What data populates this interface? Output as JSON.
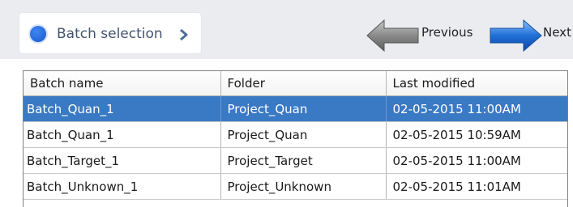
{
  "toolbar": {
    "breadcrumb_label": "Batch selection",
    "previous_label": "Previous",
    "next_label": "Next"
  },
  "grid": {
    "columns": [
      "Batch name",
      "Folder",
      "Last modified"
    ],
    "rows": [
      {
        "batch_name": "Batch_Quan_1",
        "folder": "Project_Quan",
        "last_modified": "02-05-2015 11:00AM",
        "selected": true
      },
      {
        "batch_name": "Batch_Quan_1",
        "folder": "Project_Quan",
        "last_modified": "02-05-2015 10:59AM",
        "selected": false
      },
      {
        "batch_name": "Batch_Target_1",
        "folder": "Project_Target",
        "last_modified": "02-05-2015 11:00AM",
        "selected": false
      },
      {
        "batch_name": "Batch_Unknown_1",
        "folder": "Project_Unknown",
        "last_modified": "02-05-2015 11:01AM",
        "selected": false
      }
    ]
  },
  "icons": {
    "breadcrumb_dot": "circle-dot-icon",
    "breadcrumb_chevron": "chevron-right-icon",
    "previous": "arrow-left-icon",
    "next": "arrow-right-icon"
  },
  "colors": {
    "selection": "#3a79c4",
    "dot_blue": "#2467d8",
    "next_arrow": "#1f6fd6",
    "previous_arrow": "#8a8a8a",
    "toolbar_bg": "#eaecf0"
  }
}
